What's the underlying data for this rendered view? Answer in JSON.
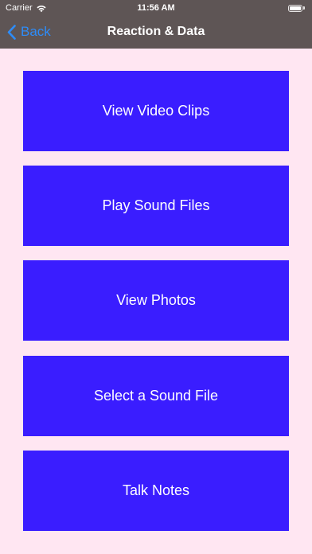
{
  "status_bar": {
    "carrier": "Carrier",
    "time": "11:56 AM",
    "battery_level": 1.0
  },
  "nav": {
    "back_label": "Back",
    "title": "Reaction & Data"
  },
  "menu": {
    "items": [
      {
        "label": "View Video Clips"
      },
      {
        "label": "Play Sound Files"
      },
      {
        "label": "View Photos"
      },
      {
        "label": "Select a Sound File"
      },
      {
        "label": "Talk Notes"
      }
    ]
  },
  "colors": {
    "background": "#FFE6F2",
    "header": "#5E5555",
    "button": "#3A1DFF",
    "back_tint": "#2E8CF7"
  },
  "icons": {
    "wifi": "wifi-icon",
    "battery": "battery-icon",
    "back": "chevron-left-icon"
  }
}
